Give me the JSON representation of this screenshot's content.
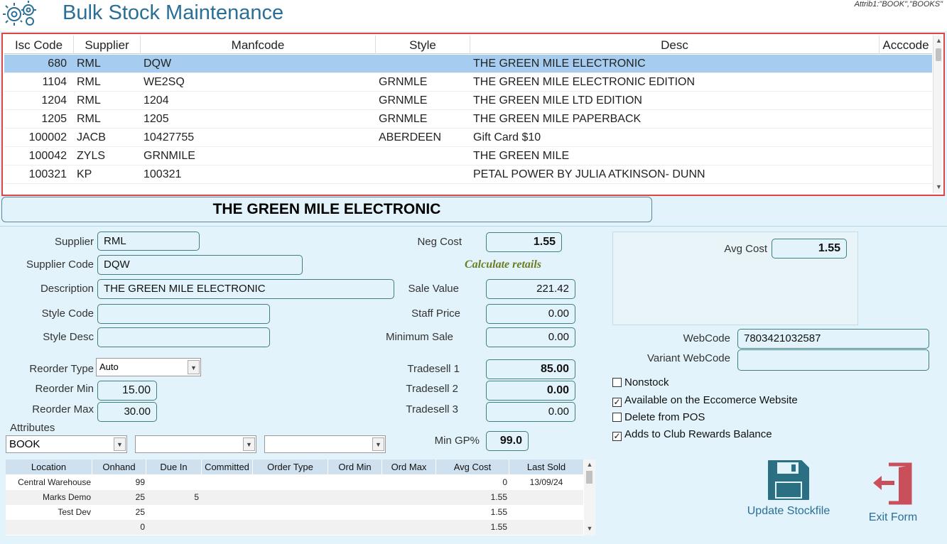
{
  "header": {
    "title": "Bulk Stock Maintenance",
    "attrib_note": "Attrib1:\"BOOK\",\"BOOKS\""
  },
  "grid": {
    "columns": [
      "Isc Code",
      "Supplier",
      "Manfcode",
      "Style",
      "Desc",
      "Acccode"
    ],
    "rows": [
      {
        "isc": "680",
        "supplier": "RML",
        "manf": "DQW",
        "style": "",
        "desc": "THE GREEN MILE ELECTRONIC"
      },
      {
        "isc": "1104",
        "supplier": "RML",
        "manf": "WE2SQ",
        "style": "GRNMLE",
        "desc": "THE GREEN MILE ELECTRONIC EDITION"
      },
      {
        "isc": "1204",
        "supplier": "RML",
        "manf": "1204",
        "style": "GRNMLE",
        "desc": "THE GREEN MILE LTD EDITION"
      },
      {
        "isc": "1205",
        "supplier": "RML",
        "manf": "1205",
        "style": "GRNMLE",
        "desc": "THE GREEN MILE PAPERBACK"
      },
      {
        "isc": "100002",
        "supplier": "JACB",
        "manf": "10427755",
        "style": "ABERDEEN",
        "desc": "Gift Card $10"
      },
      {
        "isc": "100042",
        "supplier": "ZYLS",
        "manf": "GRNMILE",
        "style": "",
        "desc": "THE GREEN MILE"
      },
      {
        "isc": "100321",
        "supplier": "KP",
        "manf": "100321",
        "style": "",
        "desc": "PETAL POWER BY JULIA ATKINSON- DUNN"
      }
    ]
  },
  "banner": "THE GREEN MILE ELECTRONIC",
  "form": {
    "supplier_label": "Supplier",
    "supplier": "RML",
    "supplier_code_label": "Supplier Code",
    "supplier_code": "DQW",
    "description_label": "Description",
    "description": "THE GREEN MILE ELECTRONIC",
    "style_code_label": "Style Code",
    "style_code": "",
    "style_desc_label": "Style Desc",
    "style_desc": "",
    "reorder_type_label": "Reorder Type",
    "reorder_type": "Auto",
    "reorder_min_label": "Reorder Min",
    "reorder_min": "15.00",
    "reorder_max_label": "Reorder Max",
    "reorder_max": "30.00",
    "attributes_label": "Attributes",
    "attribute_1": "BOOK",
    "attribute_2": "",
    "attribute_3": ""
  },
  "pricing": {
    "neg_cost_label": "Neg Cost",
    "neg_cost": "1.55",
    "calculate_retails": "Calculate retails",
    "sale_value_label": "Sale Value",
    "sale_value": "221.42",
    "staff_price_label": "Staff Price",
    "staff_price": "0.00",
    "minimum_sale_label": "Minimum Sale",
    "minimum_sale": "0.00",
    "tradesell1_label": "Tradesell 1",
    "tradesell1": "85.00",
    "tradesell2_label": "Tradesell 2",
    "tradesell2": "0.00",
    "tradesell3_label": "Tradesell 3",
    "tradesell3": "0.00",
    "min_gp_label": "Min GP%",
    "min_gp": "99.0"
  },
  "cost": {
    "avg_cost_label": "Avg Cost",
    "avg_cost": "1.55"
  },
  "web": {
    "webcode_label": "WebCode",
    "webcode": "7803421032587",
    "variant_webcode_label": "Variant WebCode",
    "variant_webcode": ""
  },
  "checks": [
    {
      "label": "Nonstock",
      "checked": false
    },
    {
      "label": "Available on the Eccomerce Website",
      "checked": true
    },
    {
      "label": "Delete from POS",
      "checked": false
    },
    {
      "label": "Adds to Club Rewards Balance",
      "checked": true
    }
  ],
  "locations": {
    "columns": [
      "Location",
      "Onhand",
      "Due In",
      "Committed",
      "Order Type",
      "Ord Min",
      "Ord Max",
      "Avg Cost",
      "Last Sold"
    ],
    "rows": [
      {
        "location": "Central Warehouse",
        "onhand": "99",
        "due_in": "",
        "avg_cost": "0",
        "last_sold": "13/09/24"
      },
      {
        "location": "Marks Demo",
        "onhand": "25",
        "due_in": "5",
        "avg_cost": "1.55",
        "last_sold": ""
      },
      {
        "location": "Test Dev",
        "onhand": "25",
        "due_in": "",
        "avg_cost": "1.55",
        "last_sold": ""
      },
      {
        "location": "",
        "onhand": "0",
        "due_in": "",
        "avg_cost": "1.55",
        "last_sold": ""
      }
    ]
  },
  "actions": {
    "update_label": "Update Stockfile",
    "exit_label": "Exit Form"
  },
  "icons": {
    "logo": "gears-icon",
    "update": "floppy-disk-icon",
    "exit": "exit-door-icon",
    "check": "✓",
    "chevron_down": "▼",
    "chevron_up": "▲"
  },
  "colors": {
    "accent": "#2a6f97",
    "selection": "#a6cdef",
    "grid_border": "#e04545",
    "exit_red": "#c94f5a",
    "calc_text": "#6b7d1e"
  }
}
